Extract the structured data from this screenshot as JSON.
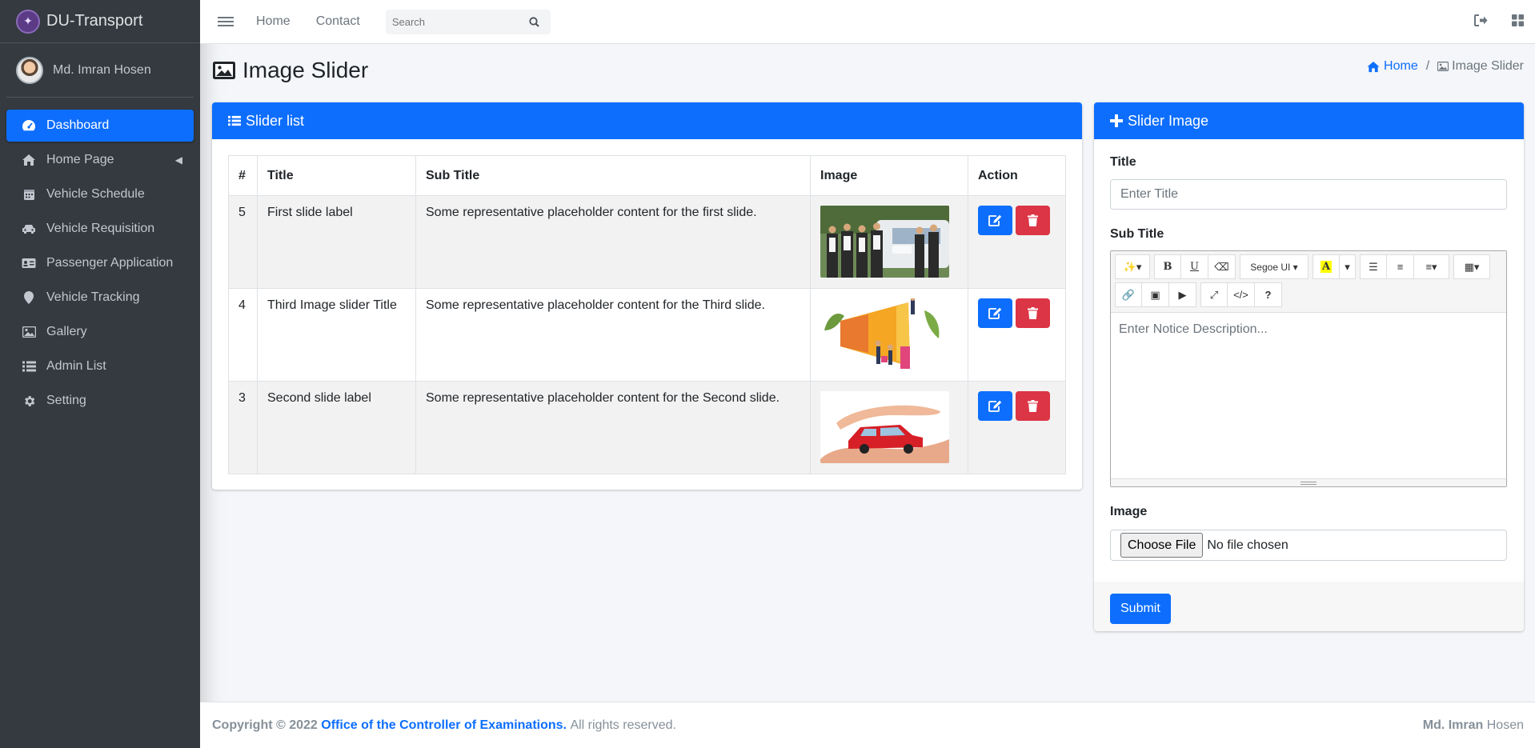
{
  "brand": {
    "name": "DU-Transport"
  },
  "user": {
    "name": "Md. Imran Hosen"
  },
  "sidebar": {
    "items": [
      {
        "label": "Dashboard",
        "icon": "dashboard-icon",
        "active": true
      },
      {
        "label": "Home Page",
        "icon": "home-icon"
      },
      {
        "label": "Vehicle Schedule",
        "icon": "calendar-icon"
      },
      {
        "label": "Vehicle Requisition",
        "icon": "car-icon"
      },
      {
        "label": "Passenger Application",
        "icon": "id-card-icon"
      },
      {
        "label": "Vehicle Tracking",
        "icon": "map-marker-icon"
      },
      {
        "label": "Gallery",
        "icon": "image-icon"
      },
      {
        "label": "Admin List",
        "icon": "list-icon"
      },
      {
        "label": "Setting",
        "icon": "gear-icon"
      }
    ]
  },
  "topbar": {
    "home": "Home",
    "contact": "Contact",
    "search_placeholder": "Search"
  },
  "page": {
    "title": "Image Slider"
  },
  "breadcrumb": {
    "home": "Home",
    "current": "Image Slider"
  },
  "slider_list": {
    "header": "Slider list",
    "columns": [
      "#",
      "Title",
      "Sub Title",
      "Image",
      "Action"
    ],
    "rows": [
      {
        "id": "5",
        "title": "First slide label",
        "subtitle": "Some representative placeholder content for the first slide."
      },
      {
        "id": "4",
        "title": "Third Image slider Title",
        "subtitle": "Some representative placeholder content for the Third slide."
      },
      {
        "id": "3",
        "title": "Second slide label",
        "subtitle": "Some representative placeholder content for the Second slide."
      }
    ]
  },
  "form": {
    "header": "Slider Image",
    "title_label": "Title",
    "title_placeholder": "Enter Title",
    "subtitle_label": "Sub Title",
    "font_name": "Segoe UI",
    "editor_placeholder": "Enter Notice Description...",
    "image_label": "Image",
    "choose_file": "Choose File",
    "file_status": "No file chosen",
    "submit": "Submit"
  },
  "footer": {
    "copyright": "Copyright © 2022",
    "org": "Office of the Controller of Examinations.",
    "rights": "All rights reserved.",
    "author_bold": "Md. Imran",
    "author_rest": "Hosen"
  },
  "colors": {
    "primary": "#0d6efd",
    "danger": "#dc3545",
    "sidebar": "#343a40"
  }
}
